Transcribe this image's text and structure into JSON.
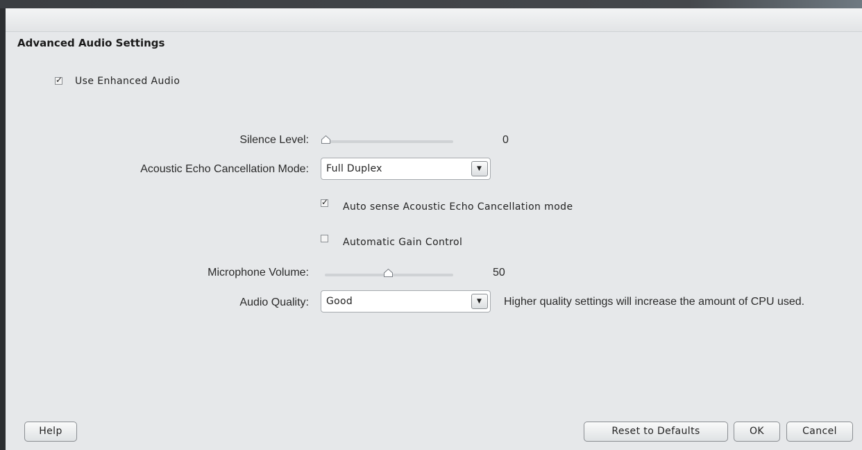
{
  "dialog": {
    "title": "Advanced Audio Settings"
  },
  "enhanced_audio": {
    "label": "Use Enhanced Audio",
    "checked": true
  },
  "silence_level": {
    "label": "Silence Level:",
    "value": "0",
    "fraction": 0.0
  },
  "aec_mode": {
    "label": "Acoustic Echo Cancellation Mode:",
    "selected": "Full Duplex",
    "dropdown_icon": "chevron-down-icon"
  },
  "auto_sense": {
    "label": "Auto sense Acoustic Echo Cancellation mode",
    "checked": true
  },
  "agc": {
    "label": "Automatic Gain Control",
    "checked": false
  },
  "microphone_volume": {
    "label": "Microphone Volume:",
    "value": "50",
    "fraction": 0.5
  },
  "audio_quality": {
    "label": "Audio Quality:",
    "selected": "Good",
    "note": "Higher quality settings will increase the amount of CPU used."
  },
  "buttons": {
    "help": "Help",
    "reset": "Reset to Defaults",
    "ok": "OK",
    "cancel": "Cancel"
  },
  "colors": {
    "dialog_bg": "#e6e8ea",
    "window_dark": "#2c2e31"
  }
}
